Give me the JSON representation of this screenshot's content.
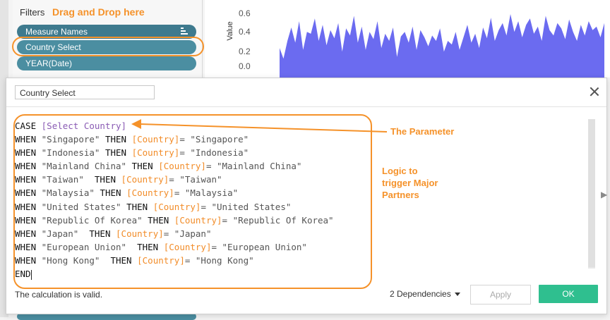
{
  "filters": {
    "label": "Filters",
    "annotation": "Drag and Drop here",
    "pills": [
      {
        "label": "Measure Names"
      },
      {
        "label": "Country Select"
      },
      {
        "label": "YEAR(Date)"
      }
    ]
  },
  "chart_data": {
    "type": "area",
    "ylabel": "Value",
    "yticks": [
      "0.6",
      "0.4",
      "0.2",
      "0.0"
    ],
    "ylim": [
      0,
      0.6
    ],
    "color": "#6b6bf0",
    "values": [
      0.22,
      0.1,
      0.3,
      0.45,
      0.28,
      0.52,
      0.2,
      0.4,
      0.38,
      0.55,
      0.3,
      0.48,
      0.25,
      0.42,
      0.33,
      0.5,
      0.18,
      0.44,
      0.36,
      0.58,
      0.28,
      0.46,
      0.2,
      0.4,
      0.32,
      0.52,
      0.22,
      0.38,
      0.3,
      0.45,
      0.12,
      0.35,
      0.4,
      0.28,
      0.46,
      0.2,
      0.42,
      0.34,
      0.24,
      0.36,
      0.3,
      0.44,
      0.18,
      0.3,
      0.26,
      0.4,
      0.2,
      0.34,
      0.48,
      0.28,
      0.38,
      0.22,
      0.45,
      0.33,
      0.56,
      0.3,
      0.42,
      0.5,
      0.36,
      0.6,
      0.4,
      0.52,
      0.34,
      0.48,
      0.55,
      0.38,
      0.46,
      0.3,
      0.58,
      0.42,
      0.36,
      0.5,
      0.44,
      0.32,
      0.54,
      0.4,
      0.3,
      0.48,
      0.36,
      0.52,
      0.42,
      0.46,
      0.34,
      0.5
    ]
  },
  "dialog": {
    "name_value": "Country Select",
    "code_lines": [
      [
        {
          "t": "kw",
          "v": "CASE "
        },
        {
          "t": "param",
          "v": "[Select Country]"
        }
      ],
      [
        {
          "t": "kw",
          "v": "WHEN "
        },
        {
          "t": "str",
          "v": "\"Singapore\" "
        },
        {
          "t": "kw",
          "v": "THEN "
        },
        {
          "t": "fld",
          "v": "[Country]"
        },
        {
          "t": "str",
          "v": "= \"Singapore\""
        }
      ],
      [
        {
          "t": "kw",
          "v": "WHEN "
        },
        {
          "t": "str",
          "v": "\"Indonesia\" "
        },
        {
          "t": "kw",
          "v": "THEN "
        },
        {
          "t": "fld",
          "v": "[Country]"
        },
        {
          "t": "str",
          "v": "= \"Indonesia\""
        }
      ],
      [
        {
          "t": "kw",
          "v": "WHEN "
        },
        {
          "t": "str",
          "v": "\"Mainland China\" "
        },
        {
          "t": "kw",
          "v": "THEN "
        },
        {
          "t": "fld",
          "v": "[Country]"
        },
        {
          "t": "str",
          "v": "= \"Mainland China\""
        }
      ],
      [
        {
          "t": "kw",
          "v": "WHEN "
        },
        {
          "t": "str",
          "v": "\"Taiwan\"  "
        },
        {
          "t": "kw",
          "v": "THEN "
        },
        {
          "t": "fld",
          "v": "[Country]"
        },
        {
          "t": "str",
          "v": "= \"Taiwan\""
        }
      ],
      [
        {
          "t": "kw",
          "v": "WHEN "
        },
        {
          "t": "str",
          "v": "\"Malaysia\" "
        },
        {
          "t": "kw",
          "v": "THEN "
        },
        {
          "t": "fld",
          "v": "[Country]"
        },
        {
          "t": "str",
          "v": "= \"Malaysia\""
        }
      ],
      [
        {
          "t": "kw",
          "v": "WHEN "
        },
        {
          "t": "str",
          "v": "\"United States\" "
        },
        {
          "t": "kw",
          "v": "THEN "
        },
        {
          "t": "fld",
          "v": "[Country]"
        },
        {
          "t": "str",
          "v": "= \"United States\""
        }
      ],
      [
        {
          "t": "kw",
          "v": "WHEN "
        },
        {
          "t": "str",
          "v": "\"Republic Of Korea\" "
        },
        {
          "t": "kw",
          "v": "THEN "
        },
        {
          "t": "fld",
          "v": "[Country]"
        },
        {
          "t": "str",
          "v": "= \"Republic Of Korea\""
        }
      ],
      [
        {
          "t": "kw",
          "v": "WHEN "
        },
        {
          "t": "str",
          "v": "\"Japan\"  "
        },
        {
          "t": "kw",
          "v": "THEN "
        },
        {
          "t": "fld",
          "v": "[Country]"
        },
        {
          "t": "str",
          "v": "= \"Japan\""
        }
      ],
      [
        {
          "t": "kw",
          "v": "WHEN "
        },
        {
          "t": "str",
          "v": "\"European Union\"  "
        },
        {
          "t": "kw",
          "v": "THEN "
        },
        {
          "t": "fld",
          "v": "[Country]"
        },
        {
          "t": "str",
          "v": "= \"European Union\""
        }
      ],
      [
        {
          "t": "kw",
          "v": "WHEN "
        },
        {
          "t": "str",
          "v": "\"Hong Kong\"  "
        },
        {
          "t": "kw",
          "v": "THEN "
        },
        {
          "t": "fld",
          "v": "[Country]"
        },
        {
          "t": "str",
          "v": "= \"Hong Kong\""
        }
      ],
      [
        {
          "t": "kw",
          "v": "END"
        }
      ]
    ],
    "annotation_parameter": "The Parameter",
    "annotation_logic": "Logic to\ntrigger Major\nPartners",
    "status": "The calculation is valid.",
    "dependencies": "2 Dependencies",
    "apply_label": "Apply",
    "ok_label": "OK"
  },
  "colors": {
    "accent_orange": "#f5922a",
    "pill": "#4b8ea1",
    "ok_green": "#2fbf8f",
    "field_orange": "#f28c28",
    "parameter_purple": "#8a5bb4"
  }
}
